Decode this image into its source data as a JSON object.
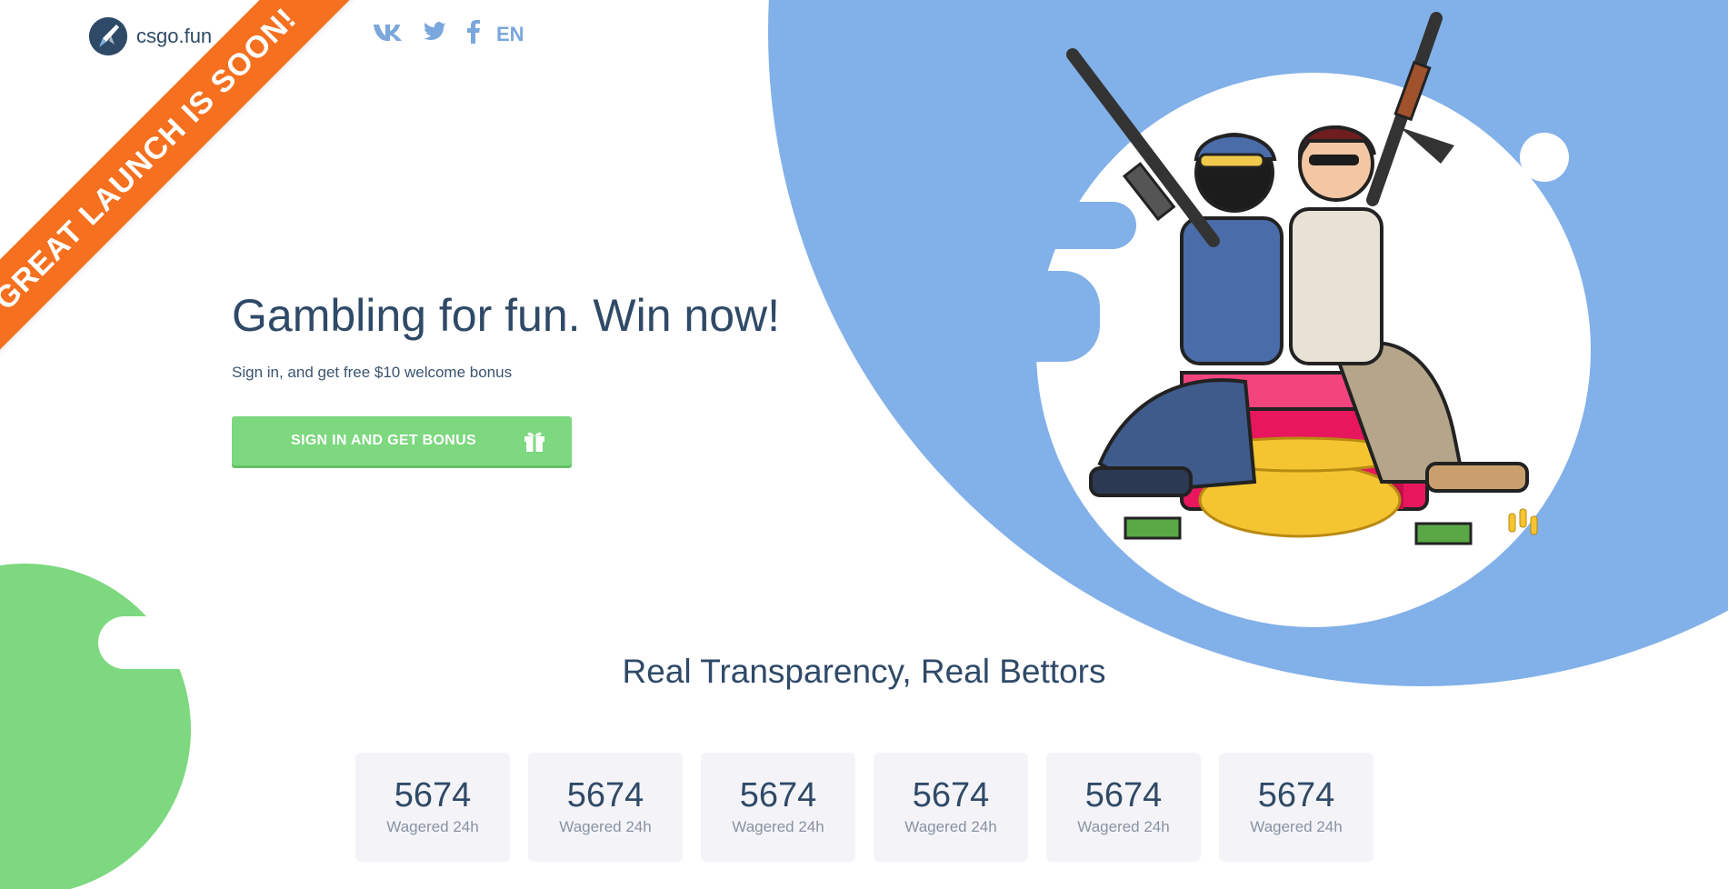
{
  "brand": {
    "name": "csgo.fun",
    "logo_icon": "rocket-icon"
  },
  "ribbon": {
    "text": "GREAT LAUNCH IS SOON!"
  },
  "socials": [
    {
      "icon": "vk-icon",
      "glyph": "vk"
    },
    {
      "icon": "twitter-icon",
      "glyph": "🐦"
    },
    {
      "icon": "facebook-icon",
      "glyph": "f"
    }
  ],
  "language": "EN",
  "hero": {
    "title": "Gambling for fun. Win now!",
    "subtitle": "Sign in, and get free $10 welcome bonus",
    "cta_label": "SIGN IN AND GET BONUS",
    "cta_icon": "gift-icon"
  },
  "stats_section": {
    "title": "Real Transparency, Real Bettors",
    "items": [
      {
        "value": "5674",
        "label": "Wagered 24h"
      },
      {
        "value": "5674",
        "label": "Wagered 24h"
      },
      {
        "value": "5674",
        "label": "Wagered 24h"
      },
      {
        "value": "5674",
        "label": "Wagered 24h"
      },
      {
        "value": "5674",
        "label": "Wagered 24h"
      },
      {
        "value": "5674",
        "label": "Wagered 24h"
      }
    ]
  },
  "colors": {
    "primary_text": "#2f4a67",
    "accent_blue": "#82b0e8",
    "accent_green": "#7dd87f",
    "ribbon_orange": "#f5701f",
    "card_bg": "#f4f4f8"
  }
}
